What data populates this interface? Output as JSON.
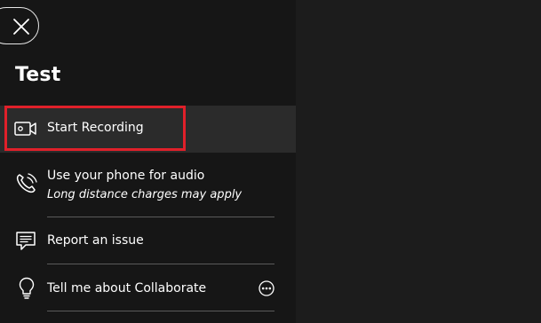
{
  "panel": {
    "title": "Test",
    "close_icon": "close-icon"
  },
  "menu": {
    "recording": {
      "label": "Start Recording",
      "icon": "video-camera-icon"
    },
    "phone": {
      "label": "Use your phone for audio",
      "sublabel": "Long distance charges may apply",
      "icon": "phone-icon"
    },
    "report": {
      "label": "Report an issue",
      "icon": "chat-feedback-icon"
    },
    "about": {
      "label": "Tell me about Collaborate",
      "icon": "lightbulb-icon",
      "more_icon": "ellipsis-circle-icon"
    }
  },
  "colors": {
    "panel_bg": "#161616",
    "page_bg": "#1c1c1c",
    "highlight": "#e0202a",
    "selected_bg": "#2b2b2b"
  }
}
